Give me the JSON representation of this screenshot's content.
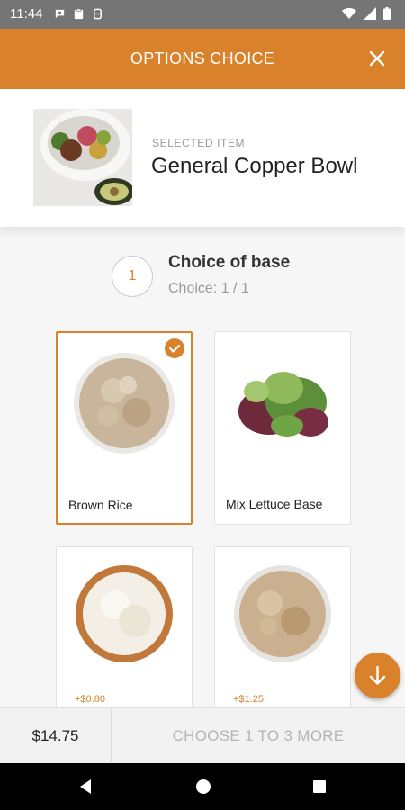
{
  "status_bar": {
    "time": "11:44",
    "left_icons": [
      "chat-icon",
      "clipboard-icon",
      "storage-icon"
    ],
    "right_icons": [
      "wifi-icon",
      "signal-icon",
      "battery-icon"
    ]
  },
  "header": {
    "title": "OPTIONS CHOICE",
    "close_icon": "close-icon"
  },
  "item": {
    "selected_label": "SELECTED ITEM",
    "name": "General Copper Bowl"
  },
  "step": {
    "number": "1",
    "title": "Choice of base",
    "subtitle": "Choice: 1 / 1"
  },
  "options": [
    {
      "label": "Brown Rice",
      "price": "",
      "selected": true
    },
    {
      "label": "Mix Lettuce Base",
      "price": "",
      "selected": false
    },
    {
      "label": "",
      "price": "+$0.80",
      "selected": false
    },
    {
      "label": "",
      "price": "+$1.25",
      "selected": false
    }
  ],
  "bottom": {
    "total": "$14.75",
    "cta": "CHOOSE 1 TO 3 MORE"
  },
  "colors": {
    "accent": "#d9822b",
    "status_bar": "#757575",
    "nav_bar": "#000000"
  }
}
